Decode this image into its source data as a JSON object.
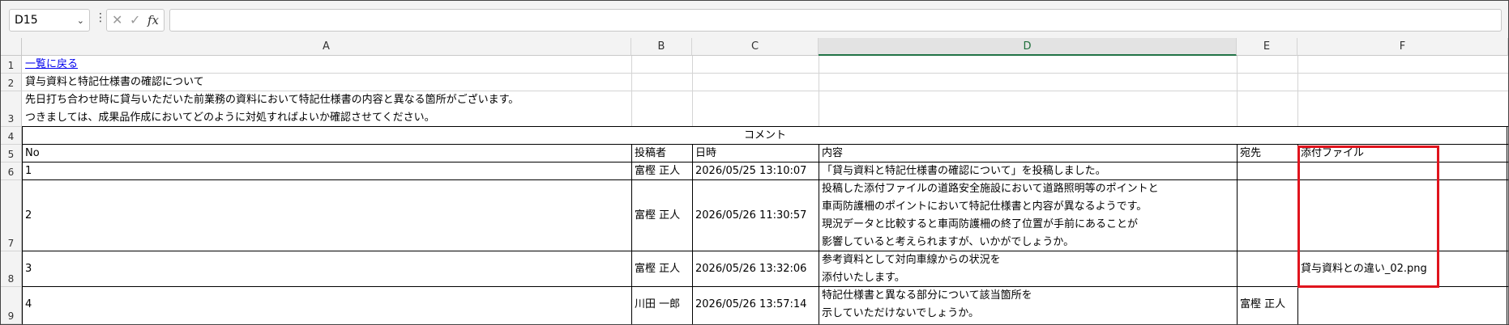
{
  "formula_bar": {
    "cell_ref": "D15",
    "chevron": "⌄",
    "more": "⋮",
    "cancel": "✕",
    "confirm": "✓",
    "fx": "fx",
    "formula": ""
  },
  "columns": [
    "A",
    "B",
    "C",
    "D",
    "E",
    "F"
  ],
  "rows": [
    "1",
    "2",
    "3",
    "4",
    "5",
    "6",
    "7",
    "8",
    "9"
  ],
  "top": {
    "back_link": "一覧に戻る",
    "subject": "貸与資料と特記仕様書の確認について",
    "body_line1": "先日打ち合わせ時に貸与いただいた前業務の資料において特記仕様書の内容と異なる箇所がございます。",
    "body_line2": "つきましては、成果品作成においてどのように対処すればよいか確認させてください。"
  },
  "comment_header": "コメント",
  "table": {
    "headers": {
      "no": "No",
      "author": "投稿者",
      "datetime": "日時",
      "content": "内容",
      "to": "宛先",
      "attachment": "添付ファイル"
    },
    "rows": [
      {
        "no": "1",
        "author": "富樫 正人",
        "datetime": "2026/05/25 13:10:07",
        "content": [
          "「貸与資料と特記仕様書の確認について」を投稿しました。"
        ],
        "to": "",
        "attachment": ""
      },
      {
        "no": "2",
        "author": "富樫 正人",
        "datetime": "2026/05/26 11:30:57",
        "content": [
          "投稿した添付ファイルの道路安全施設において道路照明等のポイントと",
          "車両防護柵のポイントにおいて特記仕様書と内容が異なるようです。",
          "現況データと比較すると車両防護柵の終了位置が手前にあることが",
          "影響していると考えられますが、いかがでしょうか。"
        ],
        "to": "",
        "attachment": ""
      },
      {
        "no": "3",
        "author": "富樫 正人",
        "datetime": "2026/05/26 13:32:06",
        "content": [
          "参考資料として対向車線からの状況を",
          "添付いたします。"
        ],
        "to": "",
        "attachment": "貸与資料との違い_02.png"
      },
      {
        "no": "4",
        "author": "川田 一郎",
        "datetime": "2026/05/26 13:57:14",
        "content": [
          "特記仕様書と異なる部分について該当箇所を",
          "示していただけないでしょうか。"
        ],
        "to": "富樫 正人",
        "attachment": ""
      }
    ]
  }
}
